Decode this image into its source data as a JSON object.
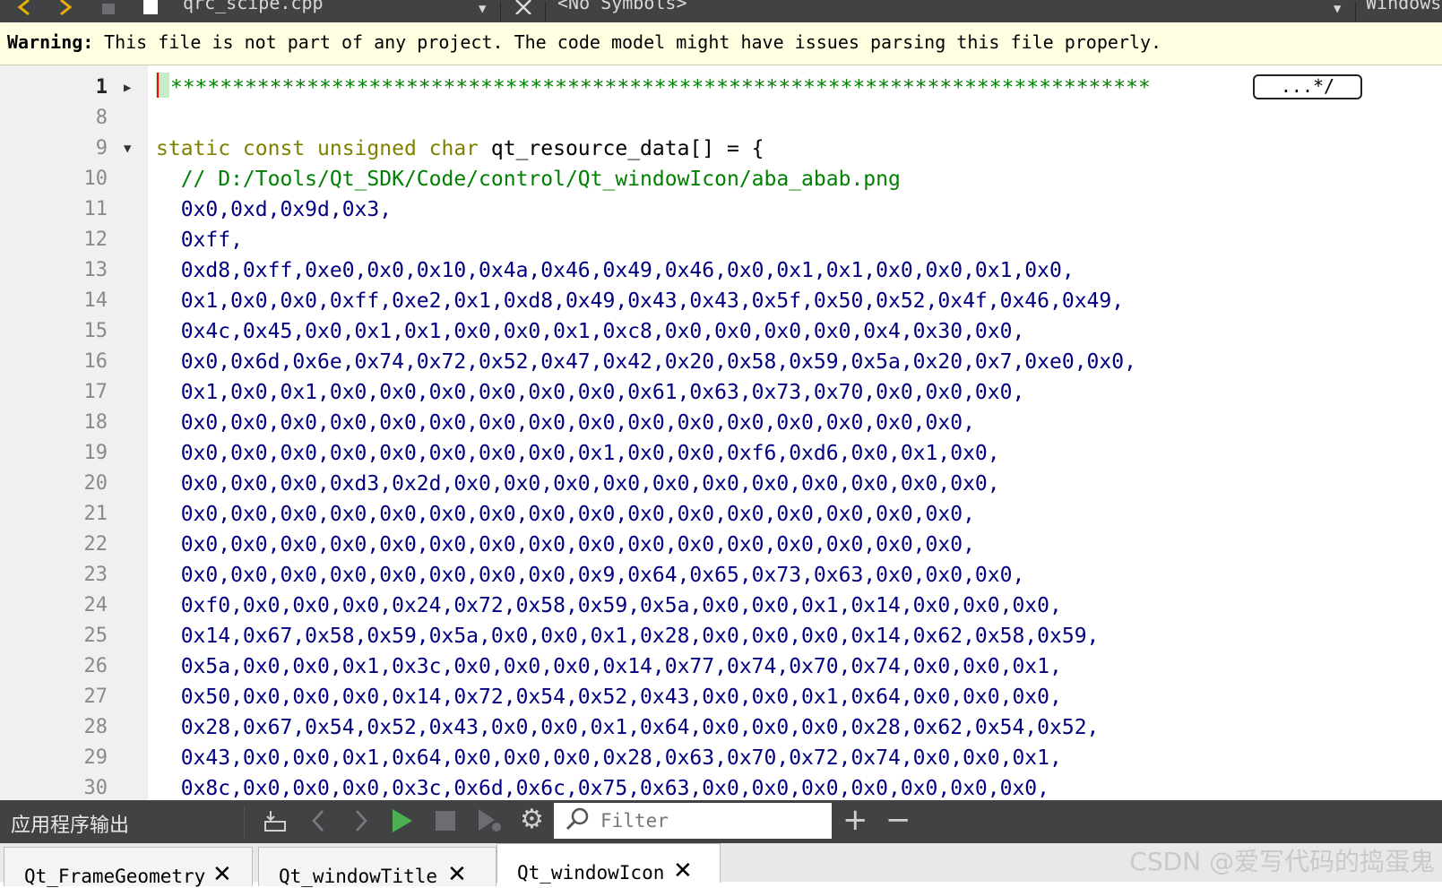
{
  "toolbar": {
    "file_name": "qrc_scipe.cpp",
    "symbols": "<No Symbols>",
    "line_endings": "Windows"
  },
  "warning": {
    "label": "Warning:",
    "message": " This file is not part of any project. The code model might have issues parsing this file properly."
  },
  "editor": {
    "fold_placeholder": "...*/",
    "lines": [
      {
        "n": "1",
        "fold": "collapsed",
        "parts": [
          {
            "t": "/",
            "c": "cm"
          },
          {
            "t": "*******************************************************************************",
            "c": "cm"
          }
        ]
      },
      {
        "n": "8",
        "fold": "",
        "parts": []
      },
      {
        "n": "9",
        "fold": "expanded",
        "parts": [
          {
            "t": "static const unsigned char",
            "c": "kw"
          },
          {
            "t": " qt_resource_data[] = {",
            "c": "pl"
          }
        ]
      },
      {
        "n": "10",
        "fold": "",
        "parts": [
          {
            "t": "  // D:/Tools/Qt_SDK/Code/control/Qt_windowIcon/aba_abab.png",
            "c": "cm"
          }
        ]
      },
      {
        "n": "11",
        "fold": "",
        "parts": [
          {
            "t": "  0x0,0xd,0x9d,0x3,",
            "c": "nm"
          }
        ]
      },
      {
        "n": "12",
        "fold": "",
        "parts": [
          {
            "t": "  0xff,",
            "c": "nm"
          }
        ]
      },
      {
        "n": "13",
        "fold": "",
        "parts": [
          {
            "t": "  0xd8,0xff,0xe0,0x0,0x10,0x4a,0x46,0x49,0x46,0x0,0x1,0x1,0x0,0x0,0x1,0x0,",
            "c": "nm"
          }
        ]
      },
      {
        "n": "14",
        "fold": "",
        "parts": [
          {
            "t": "  0x1,0x0,0x0,0xff,0xe2,0x1,0xd8,0x49,0x43,0x43,0x5f,0x50,0x52,0x4f,0x46,0x49,",
            "c": "nm"
          }
        ]
      },
      {
        "n": "15",
        "fold": "",
        "parts": [
          {
            "t": "  0x4c,0x45,0x0,0x1,0x1,0x0,0x0,0x1,0xc8,0x0,0x0,0x0,0x0,0x4,0x30,0x0,",
            "c": "nm"
          }
        ]
      },
      {
        "n": "16",
        "fold": "",
        "parts": [
          {
            "t": "  0x0,0x6d,0x6e,0x74,0x72,0x52,0x47,0x42,0x20,0x58,0x59,0x5a,0x20,0x7,0xe0,0x0,",
            "c": "nm"
          }
        ]
      },
      {
        "n": "17",
        "fold": "",
        "parts": [
          {
            "t": "  0x1,0x0,0x1,0x0,0x0,0x0,0x0,0x0,0x0,0x61,0x63,0x73,0x70,0x0,0x0,0x0,",
            "c": "nm"
          }
        ]
      },
      {
        "n": "18",
        "fold": "",
        "parts": [
          {
            "t": "  0x0,0x0,0x0,0x0,0x0,0x0,0x0,0x0,0x0,0x0,0x0,0x0,0x0,0x0,0x0,0x0,",
            "c": "nm"
          }
        ]
      },
      {
        "n": "19",
        "fold": "",
        "parts": [
          {
            "t": "  0x0,0x0,0x0,0x0,0x0,0x0,0x0,0x0,0x1,0x0,0x0,0xf6,0xd6,0x0,0x1,0x0,",
            "c": "nm"
          }
        ]
      },
      {
        "n": "20",
        "fold": "",
        "parts": [
          {
            "t": "  0x0,0x0,0x0,0xd3,0x2d,0x0,0x0,0x0,0x0,0x0,0x0,0x0,0x0,0x0,0x0,0x0,",
            "c": "nm"
          }
        ]
      },
      {
        "n": "21",
        "fold": "",
        "parts": [
          {
            "t": "  0x0,0x0,0x0,0x0,0x0,0x0,0x0,0x0,0x0,0x0,0x0,0x0,0x0,0x0,0x0,0x0,",
            "c": "nm"
          }
        ]
      },
      {
        "n": "22",
        "fold": "",
        "parts": [
          {
            "t": "  0x0,0x0,0x0,0x0,0x0,0x0,0x0,0x0,0x0,0x0,0x0,0x0,0x0,0x0,0x0,0x0,",
            "c": "nm"
          }
        ]
      },
      {
        "n": "23",
        "fold": "",
        "parts": [
          {
            "t": "  0x0,0x0,0x0,0x0,0x0,0x0,0x0,0x0,0x9,0x64,0x65,0x73,0x63,0x0,0x0,0x0,",
            "c": "nm"
          }
        ]
      },
      {
        "n": "24",
        "fold": "",
        "parts": [
          {
            "t": "  0xf0,0x0,0x0,0x0,0x24,0x72,0x58,0x59,0x5a,0x0,0x0,0x1,0x14,0x0,0x0,0x0,",
            "c": "nm"
          }
        ]
      },
      {
        "n": "25",
        "fold": "",
        "parts": [
          {
            "t": "  0x14,0x67,0x58,0x59,0x5a,0x0,0x0,0x1,0x28,0x0,0x0,0x0,0x14,0x62,0x58,0x59,",
            "c": "nm"
          }
        ]
      },
      {
        "n": "26",
        "fold": "",
        "parts": [
          {
            "t": "  0x5a,0x0,0x0,0x1,0x3c,0x0,0x0,0x0,0x14,0x77,0x74,0x70,0x74,0x0,0x0,0x1,",
            "c": "nm"
          }
        ]
      },
      {
        "n": "27",
        "fold": "",
        "parts": [
          {
            "t": "  0x50,0x0,0x0,0x0,0x14,0x72,0x54,0x52,0x43,0x0,0x0,0x1,0x64,0x0,0x0,0x0,",
            "c": "nm"
          }
        ]
      },
      {
        "n": "28",
        "fold": "",
        "parts": [
          {
            "t": "  0x28,0x67,0x54,0x52,0x43,0x0,0x0,0x1,0x64,0x0,0x0,0x0,0x28,0x62,0x54,0x52,",
            "c": "nm"
          }
        ]
      },
      {
        "n": "29",
        "fold": "",
        "parts": [
          {
            "t": "  0x43,0x0,0x0,0x1,0x64,0x0,0x0,0x0,0x28,0x63,0x70,0x72,0x74,0x0,0x0,0x1,",
            "c": "nm"
          }
        ]
      },
      {
        "n": "30",
        "fold": "",
        "parts": [
          {
            "t": "  0x8c,0x0,0x0,0x0,0x3c,0x6d,0x6c,0x75,0x63,0x0,0x0,0x0,0x0,0x0,0x0,0x0,",
            "c": "nm"
          }
        ]
      }
    ]
  },
  "output_pane": {
    "title": "应用程序输出",
    "filter_placeholder": "Filter"
  },
  "tabs": [
    {
      "label": "Qt_FrameGeometry",
      "active": false
    },
    {
      "label": "Qt_windowTitle",
      "active": false
    },
    {
      "label": "Qt_windowIcon",
      "active": true
    }
  ],
  "watermark": "CSDN @爱写代码的捣蛋鬼",
  "colors": {
    "keyword": "#808000",
    "comment": "#008000",
    "number": "#000080",
    "toolbar_bg": "#404244",
    "warning_bg": "#ffffe1"
  }
}
